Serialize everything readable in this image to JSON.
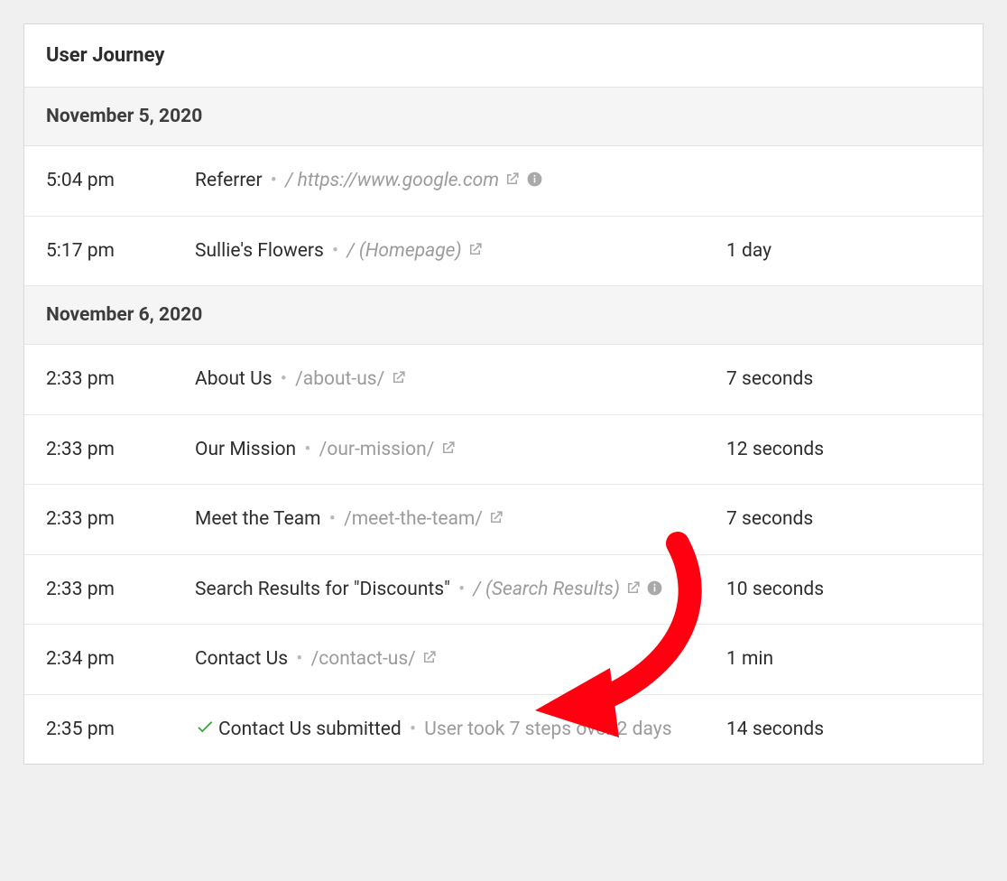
{
  "panel": {
    "title": "User Journey"
  },
  "groups": [
    {
      "date": "November 5, 2020",
      "rows": [
        {
          "time": "5:04 pm",
          "title": "Referrer",
          "path": "/ https://www.google.com",
          "pathItalic": true,
          "extLink": true,
          "infoIcon": true,
          "duration": ""
        },
        {
          "time": "5:17 pm",
          "title": "Sullie's Flowers",
          "path": "/ (Homepage)",
          "pathItalic": true,
          "extLink": true,
          "infoIcon": false,
          "duration": "1 day"
        }
      ]
    },
    {
      "date": "November 6, 2020",
      "rows": [
        {
          "time": "2:33 pm",
          "title": "About Us",
          "path": "/about-us/",
          "pathItalic": false,
          "extLink": true,
          "infoIcon": false,
          "duration": "7 seconds"
        },
        {
          "time": "2:33 pm",
          "title": "Our Mission",
          "path": "/our-mission/",
          "pathItalic": false,
          "extLink": true,
          "infoIcon": false,
          "duration": "12 seconds"
        },
        {
          "time": "2:33 pm",
          "title": "Meet the Team",
          "path": "/meet-the-team/",
          "pathItalic": false,
          "extLink": true,
          "infoIcon": false,
          "duration": "7 seconds"
        },
        {
          "time": "2:33 pm",
          "title": "Search Results for \"Discounts\"",
          "path": "/ (Search Results)",
          "pathItalic": true,
          "extLink": true,
          "infoIcon": true,
          "duration": "10 seconds"
        },
        {
          "time": "2:34 pm",
          "title": "Contact Us",
          "path": "/contact-us/",
          "pathItalic": false,
          "extLink": true,
          "infoIcon": false,
          "duration": "1 min"
        },
        {
          "time": "2:35 pm",
          "check": true,
          "title": "Contact Us submitted",
          "summary": "User took 7 steps over 2 days",
          "duration": "14 seconds"
        }
      ]
    }
  ]
}
